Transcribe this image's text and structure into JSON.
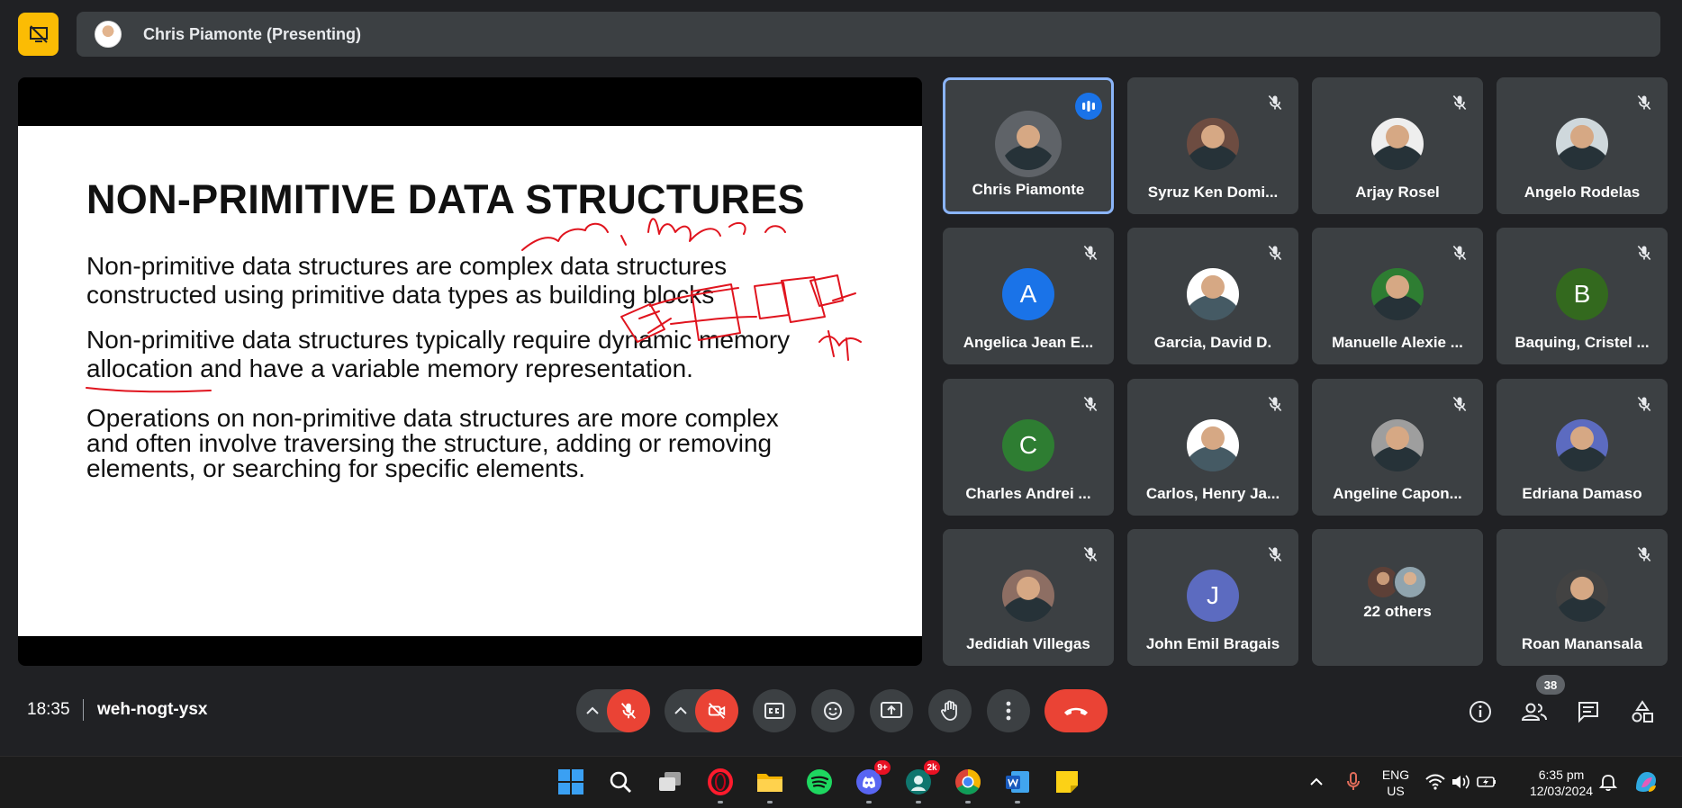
{
  "header": {
    "presenting_text": "Chris Piamonte (Presenting)"
  },
  "slide": {
    "title": "NON-PRIMITIVE DATA STRUCTURES",
    "para1_line1": "Non-primitive data structures are complex data structures",
    "para1_line2": "constructed using primitive data types as building blocks",
    "para2_line1": "Non-primitive data structures typically require dynamic memory",
    "para2_line2": "allocation and have a variable memory representation.",
    "para3_line1": "Operations on non-primitive data structures are more complex",
    "para3_line2": "and often involve traversing the structure, adding or removing",
    "para3_line3": "elements, or searching for specific elements."
  },
  "participants": [
    {
      "name": "Chris Piamonte",
      "initial": "",
      "color": "#5f6368"
    },
    {
      "name": "Syruz Ken Domi...",
      "initial": "",
      "color": "#6d4c41"
    },
    {
      "name": "Arjay Rosel",
      "initial": "",
      "color": "#eeeeee"
    },
    {
      "name": "Angelo Rodelas",
      "initial": "",
      "color": "#cfd8dc"
    },
    {
      "name": "Angelica Jean E...",
      "initial": "A",
      "color": "#1a73e8"
    },
    {
      "name": "Garcia, David D.",
      "initial": "",
      "color": "#ffffff"
    },
    {
      "name": "Manuelle Alexie ...",
      "initial": "",
      "color": "#2e7d32"
    },
    {
      "name": "Baquing, Cristel ...",
      "initial": "B",
      "color": "#33691e"
    },
    {
      "name": "Charles Andrei ...",
      "initial": "C",
      "color": "#2e7d32"
    },
    {
      "name": "Carlos, Henry Ja...",
      "initial": "",
      "color": "#ffffff"
    },
    {
      "name": "Angeline Capon...",
      "initial": "",
      "color": "#9e9e9e"
    },
    {
      "name": "Edriana Damaso",
      "initial": "",
      "color": "#5c6bc0"
    },
    {
      "name": "Jedidiah Villegas",
      "initial": "",
      "color": "#8d6e63"
    },
    {
      "name": "John Emil Bragais",
      "initial": "J",
      "color": "#5c6bc0"
    },
    {
      "name": "22 others",
      "initial": "",
      "color": "#3c4043"
    },
    {
      "name": "Roan Manansala",
      "initial": "",
      "color": "#424242"
    }
  ],
  "meeting": {
    "time": "18:35",
    "code": "weh-nogt-ysx",
    "participant_count": "38"
  },
  "taskbar": {
    "discord_badge": "9+",
    "app_badge": "2k",
    "lang_line1": "ENG",
    "lang_line2": "US",
    "clock_time": "6:35 pm",
    "clock_date": "12/03/2024"
  },
  "colors": {
    "accent_blue": "#8ab4f8",
    "end_call_red": "#ea4335",
    "share_yellow": "#fbbc04",
    "ink_red": "#e0141e"
  }
}
